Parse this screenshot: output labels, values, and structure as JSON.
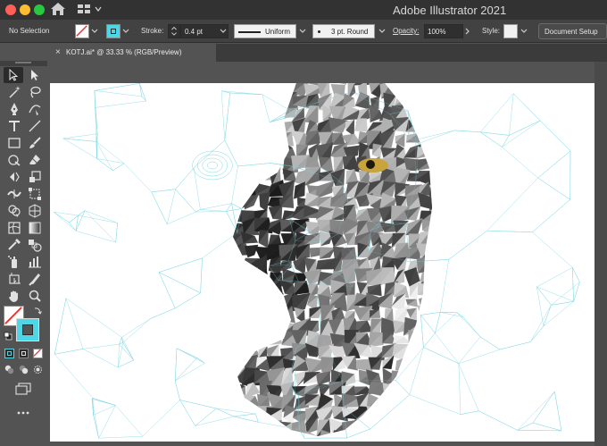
{
  "app": {
    "title": "Adobe Illustrator 2021"
  },
  "control_bar": {
    "selection": "No Selection",
    "stroke_label": "Stroke:",
    "stroke_weight": "0.4 pt",
    "profile": "Uniform",
    "brush": "3 pt. Round",
    "opacity_label": "Opacity:",
    "opacity_value": "100%",
    "style_label": "Style:",
    "document_setup": "Document Setup"
  },
  "document_tab": {
    "close": "×",
    "name": "KOTJ.ai* @ 33.33 % (RGB/Preview)"
  },
  "toolbar": {
    "tools": [
      "selection",
      "direct-selection",
      "magic-wand",
      "lasso",
      "pen",
      "curvature",
      "type",
      "line-segment",
      "rectangle",
      "paintbrush",
      "shaper",
      "eraser",
      "rotate",
      "scale",
      "width",
      "free-transform",
      "shape-builder",
      "perspective-grid",
      "mesh",
      "gradient",
      "eyedropper",
      "blend",
      "symbol-sprayer",
      "column-graph",
      "artboard",
      "slice",
      "hand",
      "zoom"
    ]
  },
  "colors": {
    "fill_stroke_accent": "#4fd6e4",
    "swatch_red_slash": "#e5312b",
    "mesh_line": "#7fd8e2",
    "eye": "#c9a33b"
  }
}
